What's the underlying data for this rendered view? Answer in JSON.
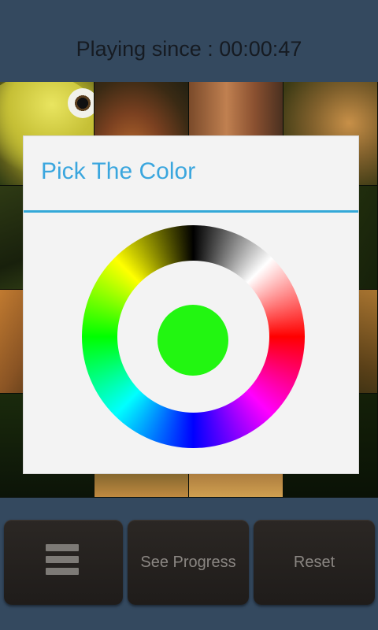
{
  "header": {
    "timer_label": "Playing since : 00:00:47"
  },
  "dialog": {
    "title": "Pick The Color",
    "selected_color": "#22f611",
    "wheel_hues": [
      "black",
      "white",
      "red",
      "magenta",
      "blue",
      "cyan",
      "green",
      "yellow"
    ]
  },
  "bottom_bar": {
    "menu_icon": "menu-icon",
    "see_progress_label": "See Progress",
    "reset_label": "Reset"
  },
  "colors": {
    "background": "#34495f",
    "accent": "#3aa6de",
    "button_bg": "#241f1c",
    "button_text": "#8a8682"
  }
}
